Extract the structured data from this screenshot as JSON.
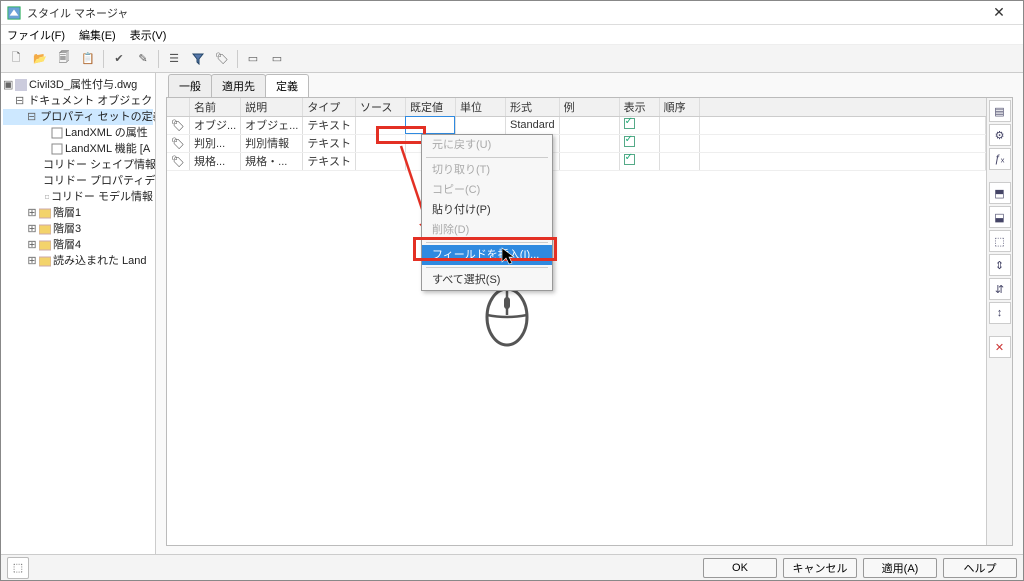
{
  "window": {
    "title": "スタイル マネージャ"
  },
  "menus": {
    "file": "ファイル(F)",
    "edit": "編集(E)",
    "view": "表示(V)"
  },
  "tree": {
    "root": "Civil3D_属性付与.dwg",
    "n1": "ドキュメント オブジェクト",
    "n2": "プロパティ セットの定義",
    "n2a": "LandXML の属性",
    "n2b": "LandXML 機能 [A",
    "n2c": "コリドー シェイプ情報",
    "n2d": "コリドー プロパティデ",
    "n2e": "コリドー モデル情報",
    "n3": "階層1",
    "n4": "階層3",
    "n5": "階層4",
    "n6": "読み込まれた Land"
  },
  "tabs": {
    "general": "一般",
    "appliesto": "適用先",
    "define": "定義"
  },
  "cols": {
    "name": "名前",
    "desc": "説明",
    "type": "タイプ",
    "src": "ソース",
    "def": "既定値",
    "unit": "単位",
    "fmt": "形式",
    "ex": "例",
    "disp": "表示",
    "ord": "順序"
  },
  "rows": [
    {
      "name": "オブジ...",
      "desc": "オブジェ...",
      "type": "テキスト",
      "src": "",
      "def": "",
      "unit": "",
      "fmt": "Standard",
      "ex": "",
      "disp": true
    },
    {
      "name": "判別...",
      "desc": "判別情報",
      "type": "テキスト",
      "src": "",
      "def": "",
      "unit": "",
      "fmt": "",
      "ex": "",
      "disp": true
    },
    {
      "name": "規格...",
      "desc": "規格・...",
      "type": "テキスト",
      "src": "",
      "def": "",
      "unit": "",
      "fmt": "",
      "ex": "",
      "disp": true
    }
  ],
  "ctx": {
    "undo": "元に戻す(U)",
    "cut": "切り取り(T)",
    "copy": "コピー(C)",
    "paste": "貼り付け(P)",
    "delete": "削除(D)",
    "insertfield": "フィールドを挿入(I)...",
    "selectall": "すべて選択(S)"
  },
  "buttons": {
    "ok": "OK",
    "cancel": "キャンセル",
    "apply": "適用(A)",
    "help": "ヘルプ"
  }
}
